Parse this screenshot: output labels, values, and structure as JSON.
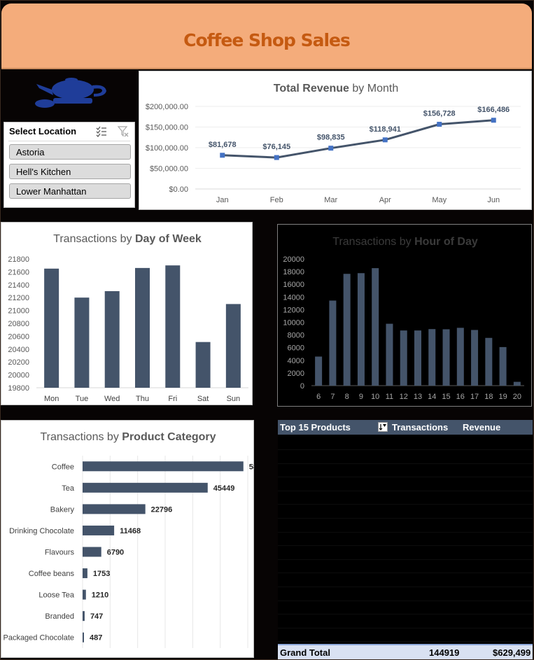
{
  "header": {
    "title": "Coffee Shop Sales"
  },
  "slicer": {
    "title": "Select Location",
    "items": [
      "Astoria",
      "Hell's Kitchen",
      "Lower Manhattan"
    ]
  },
  "colors": {
    "bar": "#44546a",
    "header_bg": "#f4ac7b",
    "header_text": "#c55a11",
    "line_marker": "#4472c4"
  },
  "revenue_chart": {
    "title_bold": "Total Revenue",
    "title_rest": " by Month",
    "y_ticks": [
      "$0.00",
      "$50,000.00",
      "$100,000.00",
      "$150,000.00",
      "$200,000.00"
    ],
    "data_labels": [
      "$81,678",
      "$76,145",
      "$98,835",
      "$118,941",
      "$156,728",
      "$166,486"
    ]
  },
  "dow_chart": {
    "title_rest": "Transactions by ",
    "title_bold": "Day of Week",
    "y_ticks": [
      "19800",
      "20000",
      "20200",
      "20400",
      "20600",
      "20800",
      "21000",
      "21200",
      "21400",
      "21600",
      "21800"
    ]
  },
  "hour_chart": {
    "title_rest": "Transactions by ",
    "title_bold": "Hour of Day",
    "y_ticks": [
      "0",
      "2000",
      "4000",
      "6000",
      "8000",
      "10000",
      "12000",
      "14000",
      "16000",
      "18000",
      "20000"
    ]
  },
  "category_chart": {
    "title_rest": "Transactions by ",
    "title_bold": "Product Category"
  },
  "products_table": {
    "headers": {
      "product": "Top 15 Products",
      "transactions": "Transactions",
      "revenue": "Revenue"
    },
    "grand_total": {
      "label": "Grand Total",
      "transactions": "144919",
      "revenue": "$629,499"
    }
  },
  "chart_data": [
    {
      "type": "line",
      "title": "Total Revenue by Month",
      "categories": [
        "Jan",
        "Feb",
        "Mar",
        "Apr",
        "May",
        "Jun"
      ],
      "values": [
        81678,
        76145,
        98835,
        118941,
        156728,
        166486
      ],
      "ylim": [
        0,
        200000
      ],
      "grid": true
    },
    {
      "type": "bar",
      "title": "Transactions by Day of Week",
      "categories": [
        "Mon",
        "Tue",
        "Wed",
        "Thu",
        "Fri",
        "Sat",
        "Sun"
      ],
      "values": [
        21650,
        21200,
        21300,
        21660,
        21700,
        20510,
        21100
      ],
      "ylim": [
        19800,
        21800
      ],
      "grid": false
    },
    {
      "type": "bar",
      "title": "Transactions by Hour of Day",
      "categories": [
        "6",
        "7",
        "8",
        "9",
        "10",
        "11",
        "12",
        "13",
        "14",
        "15",
        "16",
        "17",
        "18",
        "19",
        "20"
      ],
      "values": [
        4590,
        13430,
        17650,
        17760,
        18550,
        9770,
        8710,
        8710,
        8930,
        8900,
        9130,
        8790,
        7540,
        6090,
        600
      ],
      "ylim": [
        0,
        20000
      ],
      "grid": false
    },
    {
      "type": "bar",
      "orientation": "horizontal",
      "title": "Transactions by Product Category",
      "categories": [
        "Coffee",
        "Tea",
        "Bakery",
        "Drinking Chocolate",
        "Flavours",
        "Coffee beans",
        "Loose Tea",
        "Branded",
        "Packaged Chocolate"
      ],
      "values": [
        58416,
        45449,
        22796,
        11468,
        6790,
        1753,
        1210,
        747,
        487
      ],
      "xlim": [
        0,
        60000
      ],
      "grid": true
    }
  ]
}
